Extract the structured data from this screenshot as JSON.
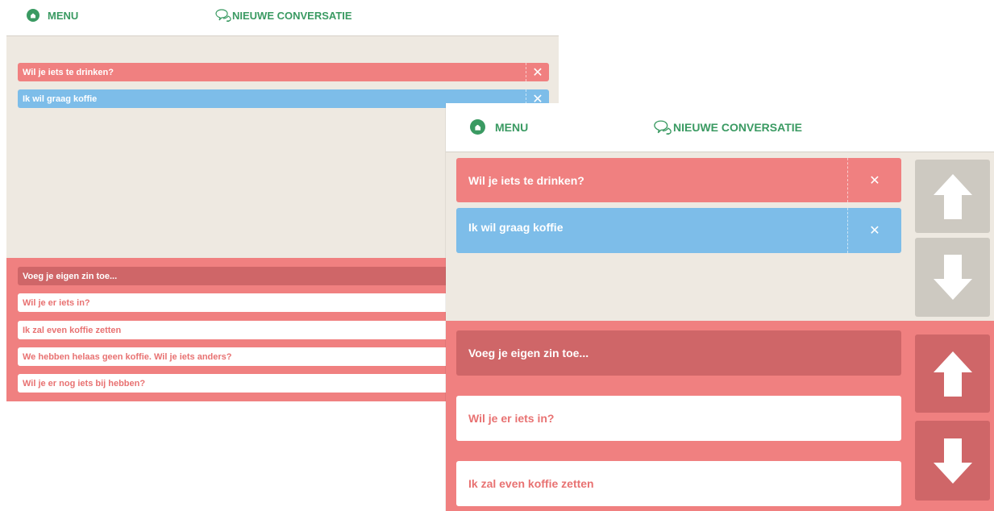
{
  "topbar": {
    "menu_label": "MENU",
    "new_conversation_label": "NIEUWE CONVERSATIE"
  },
  "conversation": [
    {
      "text": "Wil je iets te drinken?",
      "color": "#f08080"
    },
    {
      "text": "Ik wil graag koffie",
      "color": "#7dbde9"
    }
  ],
  "suggestions": {
    "add_own": "Voeg je eigen zin toe...",
    "items": [
      "Wil je er iets in?",
      "Ik zal even koffie zetten",
      "We hebben helaas geen koffie. Wil je iets anders?",
      "Wil je er nog iets bij hebben?"
    ]
  },
  "colors": {
    "accent_green": "#3a9a62",
    "conversation_bg": "#eee9e1",
    "red": "#f08080",
    "blue": "#7dbde9",
    "dark_red": "#cf6668",
    "grey_button": "#cdc9c1"
  },
  "icons": {
    "home": "home-icon",
    "chat": "chat-bubbles-icon",
    "close": "close-icon",
    "up": "arrow-up-icon",
    "down": "arrow-down-icon"
  }
}
